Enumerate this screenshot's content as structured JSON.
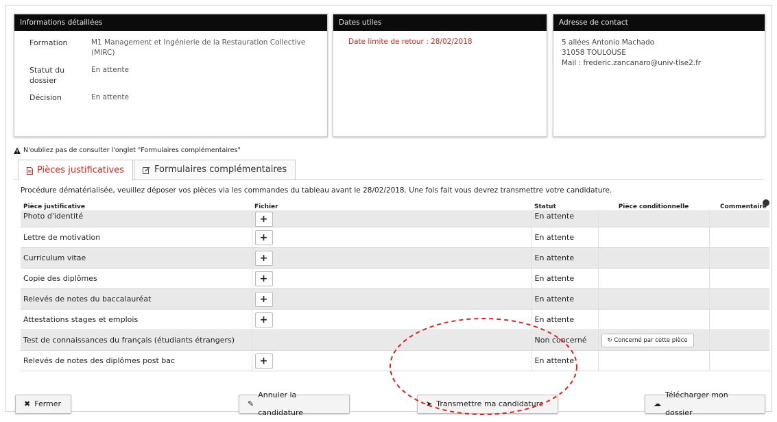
{
  "panels": {
    "info": {
      "title": "Informations détaillées",
      "formation_label": "Formation",
      "formation_value": "M1 Management et Ingénierie de la Restauration Collective (MIRC)",
      "statut_label": "Statut du dossier",
      "statut_value": "En attente",
      "decision_label": "Décision",
      "decision_value": "En attente"
    },
    "dates": {
      "title": "Dates utiles",
      "deadline": "Date limite de retour : 28/02/2018"
    },
    "contact": {
      "title": "Adresse de contact",
      "line1": "5 allées Antonio Machado",
      "line2": "31058 TOULOUSE",
      "line3": "Mail : frederic.zancanaro@univ-tlse2.fr"
    }
  },
  "warning": "N'oubliez pas de consulter l'onglet \"Formulaires complémentaires\"",
  "tabs": {
    "pieces": "Pièces justificatives",
    "formulaires": "Formulaires complémentaires"
  },
  "description": "Procédure dématérialisée, veuillez déposer vos pièces via les commandes du tableau avant le 28/02/2018. Une fois fait vous devrez transmettre votre candidature.",
  "table": {
    "headers": {
      "piece": "Pièce justificative",
      "fichier": "Fichier",
      "statut": "Statut",
      "conditionnelle": "Pièce conditionnelle",
      "commentaire": "Commentaire"
    },
    "rows": [
      {
        "piece": "Photo d'identité",
        "statut": "En attente"
      },
      {
        "piece": "Lettre de motivation",
        "statut": "En attente"
      },
      {
        "piece": "Curriculum vitae",
        "statut": "En attente"
      },
      {
        "piece": "Copie des diplômes",
        "statut": "En attente"
      },
      {
        "piece": "Relevés de notes du baccalauréat",
        "statut": "En attente"
      },
      {
        "piece": "Attestations stages et emplois",
        "statut": "En attente"
      },
      {
        "piece": "Test de connaissances du français (étudiants étrangers)",
        "statut": "Non concerné",
        "cond_button": "Concerné par cette pièce"
      },
      {
        "piece": "Relevés de notes des diplômes post bac",
        "statut": "En attente"
      }
    ],
    "plus_symbol": "+"
  },
  "buttons": {
    "fermer": "Fermer",
    "annuler": "Annuler la candidature",
    "transmettre": "Transmettre ma candidature",
    "telecharger": "Télécharger mon dossier"
  },
  "colors": {
    "accent": "#d9261c",
    "header": "#0b0b0b"
  }
}
